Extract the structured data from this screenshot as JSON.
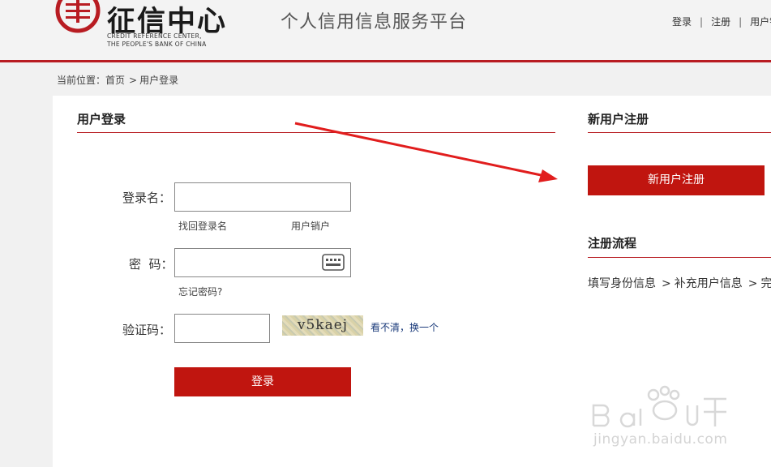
{
  "brand": {
    "name_cn": "征信中心",
    "name_en_line1": "CREDIT REFERENCE CENTER,",
    "name_en_line2": "THE PEOPLE'S BANK OF CHINA",
    "color": "#b81c22"
  },
  "site_title": "个人信用信息服务平台",
  "top_nav": {
    "login": "登录",
    "register": "注册",
    "user": "用户销"
  },
  "breadcrumb": {
    "prefix": "当前位置：",
    "home": "首页",
    "separator": ">",
    "current": "用户登录"
  },
  "login": {
    "title": "用户登录",
    "username_label": "登录名：",
    "username_value": "",
    "recover_username": "找回登录名",
    "cancel_account": "用户销户",
    "password_label": "密  码：",
    "password_value": "",
    "keyboard_icon": "keyboard-icon",
    "forgot_password": "忘记密码?",
    "captcha_label": "验证码：",
    "captcha_value": "",
    "captcha_text": "v5kaej",
    "refresh_captcha": "看不清，换一个",
    "submit": "登录",
    "button_color": "#c0150f"
  },
  "register": {
    "title": "新用户注册",
    "button": "新用户注册",
    "flow_title": "注册流程",
    "steps": [
      "填写身份信息",
      "补充用户信息",
      "完成"
    ]
  },
  "watermark": {
    "text": "jingyan.baidu.com"
  }
}
